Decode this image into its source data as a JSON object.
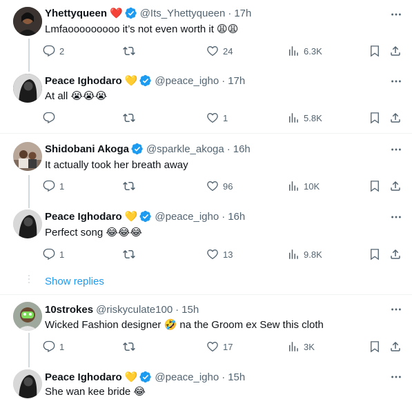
{
  "tweets": [
    {
      "name": "Yhettyqueen",
      "badge_emoji": "❤️",
      "handle": "@Its_Yhettyqueen",
      "time": "17h",
      "text": "Lmfaooooooooo it’s not even worth it 😩😩",
      "replies": "2",
      "retweets": "",
      "likes": "24",
      "views": "6.3K"
    },
    {
      "name": "Peace Ighodaro",
      "badge_emoji": "💛",
      "handle": "@peace_igho",
      "time": "17h",
      "text": "At all 😭😭😭",
      "replies": "",
      "retweets": "",
      "likes": "1",
      "views": "5.8K"
    },
    {
      "name": "Shidobani Akoga",
      "badge_emoji": "",
      "handle": "@sparkle_akoga",
      "time": "16h",
      "text": "It actually took her breath away",
      "replies": "1",
      "retweets": "",
      "likes": "96",
      "views": "10K"
    },
    {
      "name": "Peace Ighodaro",
      "badge_emoji": "💛",
      "handle": "@peace_igho",
      "time": "16h",
      "text": "Perfect song 😂😂😂",
      "replies": "1",
      "retweets": "",
      "likes": "13",
      "views": "9.8K"
    },
    {
      "name": "10strokes",
      "badge_emoji": "",
      "handle": "@riskyculate100",
      "time": "15h",
      "text": "Wicked Fashion designer 🤣 na the Groom ex Sew this cloth",
      "replies": "1",
      "retweets": "",
      "likes": "17",
      "views": "3K"
    },
    {
      "name": "Peace Ighodaro",
      "badge_emoji": "💛",
      "handle": "@peace_igho",
      "time": "15h",
      "text": "She wan kee bride 😂",
      "replies": "",
      "retweets": "",
      "likes": "",
      "views": ""
    }
  ],
  "show_replies_label": "Show replies",
  "colors": {
    "accent": "#1d9bf0",
    "muted": "#536471",
    "line": "#cfd9de"
  }
}
